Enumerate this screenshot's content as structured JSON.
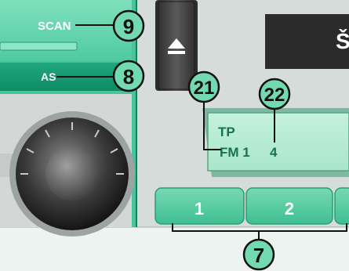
{
  "left_panel": {
    "scan_label": "SCAN",
    "as_label": "AS"
  },
  "display": {
    "line1": "TP",
    "band": "FM 1",
    "preset_no": "4",
    "top_right_glyph": "Š"
  },
  "preset_buttons": [
    {
      "label": "1"
    },
    {
      "label": "2"
    }
  ],
  "callouts": [
    {
      "number": "9",
      "target": "scan-button"
    },
    {
      "number": "8",
      "target": "as-button"
    },
    {
      "number": "21",
      "target": "band-indicator"
    },
    {
      "number": "22",
      "target": "preset-number-indicator"
    },
    {
      "number": "7",
      "target": "preset-buttons"
    }
  ],
  "icons": {
    "eject": "eject-icon"
  },
  "colors": {
    "panel_green": "#3fbf9a",
    "display_green": "#b8ecd6",
    "callout_fill": "#72d9b0",
    "body_gray": "#d9dedd",
    "dark": "#1d1d1d"
  }
}
